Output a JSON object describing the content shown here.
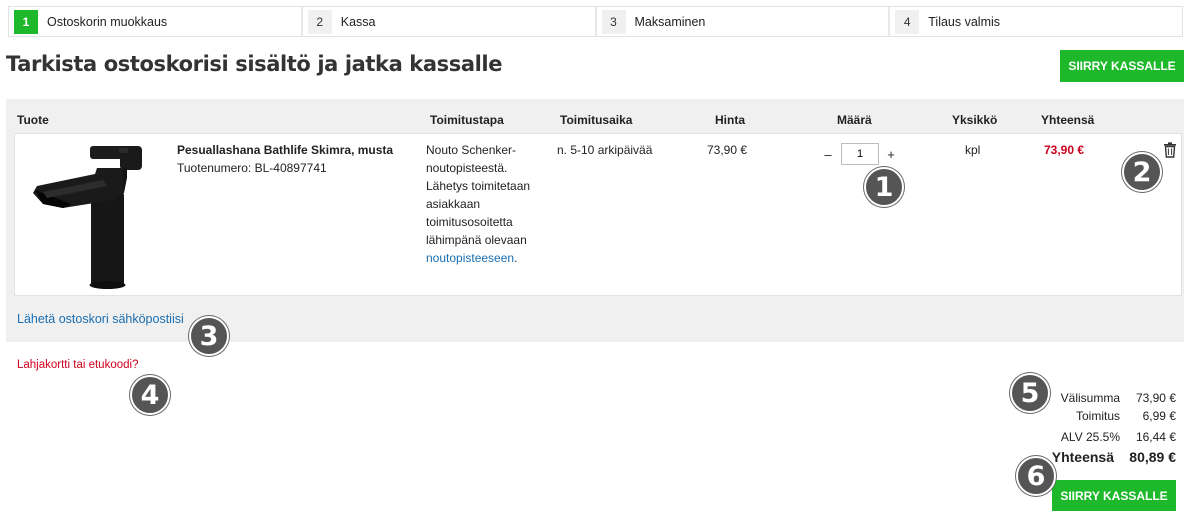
{
  "steps": [
    {
      "num": "1",
      "label": "Ostoskorin muokkaus",
      "active": true
    },
    {
      "num": "2",
      "label": "Kassa"
    },
    {
      "num": "3",
      "label": "Maksaminen"
    },
    {
      "num": "4",
      "label": "Tilaus valmis"
    }
  ],
  "title": "Tarkista ostoskorisi sisältö ja jatka kassalle",
  "checkout_label": "SIIRRY KASSALLE",
  "columns": [
    "Tuote",
    "Toimitustapa",
    "Toimitusaika",
    "Hinta",
    "Määrä",
    "Yksikkö",
    "Yhteensä"
  ],
  "item": {
    "name": "Pesuallashana Bathlife Skimra, musta",
    "sku": "Tuotenumero: BL-40897741",
    "delivery_lines": [
      "Nouto Schenker-",
      "noutopisteestä.",
      "Lähetys toimitetaan",
      "asiakkaan",
      "toimitusosoitetta",
      "lähimpänä olevaan"
    ],
    "delivery_link": "noutopisteeseen",
    "delivery_suffix": ".",
    "delivery_time": "n. 5-10 arkipäivää",
    "price": "73,90 €",
    "qty_minus": "–",
    "qty": "1",
    "qty_plus": "+",
    "unit": "kpl",
    "total": "73,90 €"
  },
  "email_link": "Lähetä ostoskori sähköpostiisi",
  "gift_link": "Lahjakortti tai etukoodi?",
  "summary": {
    "subtotal_label": "Välisumma",
    "subtotal": "73,90 €",
    "shipping_label": "Toimitus",
    "shipping": "6,99 €",
    "vat_label": "ALV 25.5%",
    "vat": "16,44 €",
    "total_label": "Yhteensä",
    "total": "80,89 €"
  },
  "badges": [
    "1",
    "2",
    "3",
    "4",
    "5",
    "6"
  ],
  "colors": {
    "accent": "#1db92b",
    "link": "#1a6eb0",
    "price": "#c8001e",
    "badge": "#555555"
  }
}
